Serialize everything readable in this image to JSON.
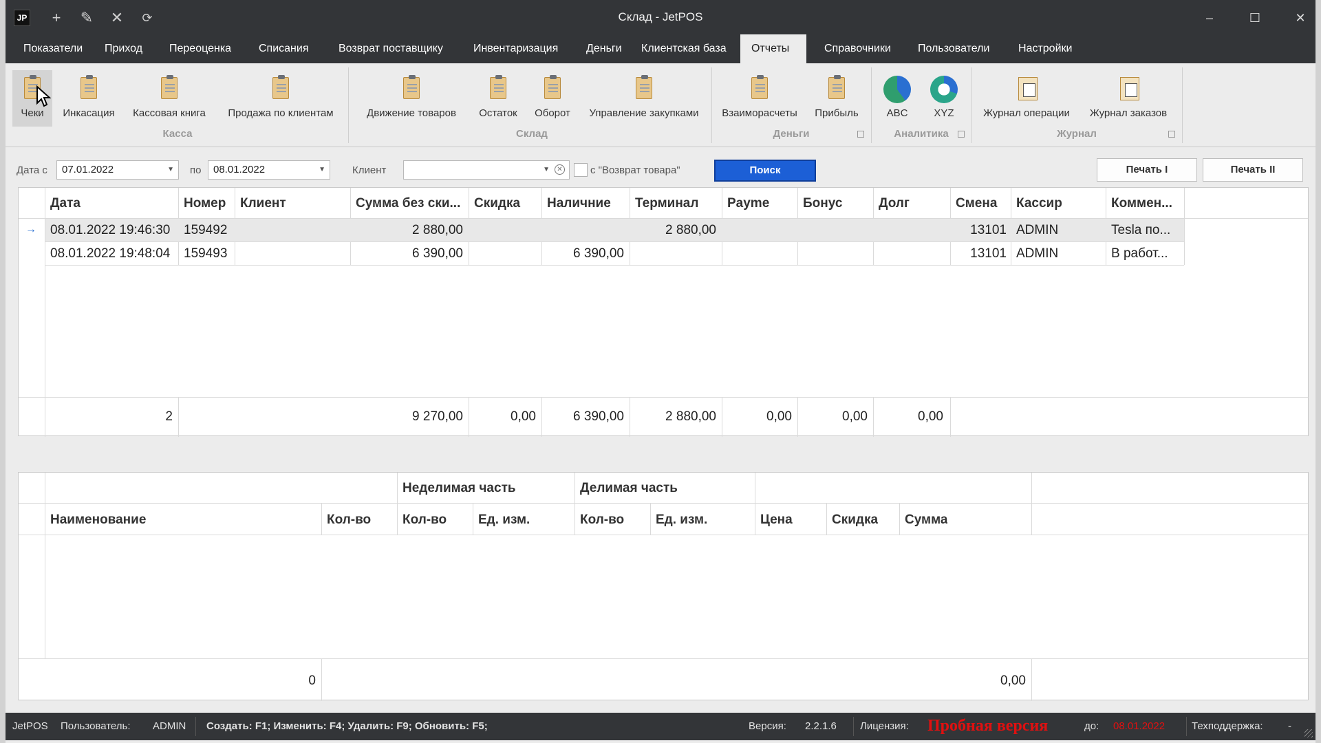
{
  "window": {
    "title": "Склад - JetPOS",
    "logo": "JP"
  },
  "toolbar_icons": [
    "plus-icon",
    "pencil-icon",
    "close-icon",
    "refresh-icon"
  ],
  "menu": {
    "tabs": [
      "Показатели",
      "Приход",
      "Переоценка",
      "Списания",
      "Возврат поставщику",
      "Инвентаризация",
      "Деньги",
      "Клиентская база",
      "Отчеты",
      "Справочники",
      "Пользователи",
      "Настройки"
    ],
    "active": "Отчеты"
  },
  "ribbon": {
    "groups": {
      "kassa": "Касса",
      "sklad": "Склад",
      "dengi": "Деньги",
      "analytics": "Аналитика",
      "journal": "Журнал"
    },
    "buttons": {
      "cheki": "Чеки",
      "inkassaciya": "Инкасация",
      "kassovaya_kniga": "Кассовая книга",
      "prodazha_po_klientam": "Продажа по клиентам",
      "dvizhenie_tovarov": "Движение товаров",
      "ostatok": "Остаток",
      "oborot": "Оборот",
      "upravlenie_zakupkami": "Управление закупками",
      "vzaimoraschety": "Взаиморасчеты",
      "pribyl": "Прибыль",
      "abc": "ABC",
      "xyz": "XYZ",
      "zhurnal_operacii": "Журнал операции",
      "zhurnal_zakazov": "Журнал заказов"
    },
    "colors": {
      "abc_green": "#2f9e6e",
      "abc_blue": "#2a6fd1",
      "xyz_teal": "#2aa58a"
    }
  },
  "filter": {
    "date_from_label": "Дата с",
    "date_from": "07.01.2022",
    "date_to_label": "по",
    "date_to": "08.01.2022",
    "client_label": "Клиент",
    "client_value": "",
    "return_checkbox_label": "с \"Возврат товара\"",
    "search_button": "Поиск",
    "print1": "Печать I",
    "print2": "Печать II"
  },
  "receipts": {
    "columns": [
      "Дата",
      "Номер",
      "Клиент",
      "Сумма без ски...",
      "Скидка",
      "Наличние",
      "Терминал",
      "Payme",
      "Бонус",
      "Долг",
      "Смена",
      "Кассир",
      "Коммен..."
    ],
    "rows": [
      {
        "date": "08.01.2022 19:46:30",
        "number": "159492",
        "client": "",
        "sum": "2 880,00",
        "discount": "",
        "cash": "",
        "terminal": "2 880,00",
        "payme": "",
        "bonus": "",
        "debt": "",
        "shift": "13101",
        "cashier": "ADMIN",
        "comment": "Tesla по..."
      },
      {
        "date": "08.01.2022 19:48:04",
        "number": "159493",
        "client": "",
        "sum": "6 390,00",
        "discount": "",
        "cash": "6 390,00",
        "terminal": "",
        "payme": "",
        "bonus": "",
        "debt": "",
        "shift": "13101",
        "cashier": "ADMIN",
        "comment": "В работ..."
      }
    ],
    "totals": {
      "count": "2",
      "sum": "9 270,00",
      "discount": "0,00",
      "cash": "6 390,00",
      "terminal": "2 880,00",
      "payme": "0,00",
      "bonus": "0,00",
      "debt": "0,00"
    },
    "selected_row_indicator": "→"
  },
  "items": {
    "band_indivisible": "Неделимая часть",
    "band_divisible": "Делимая часть",
    "columns": [
      "Наименование",
      "Кол-во",
      "Кол-во",
      "Ед. изм.",
      "Кол-во",
      "Ед. изм.",
      "Цена",
      "Скидка",
      "Сумма"
    ],
    "totals": {
      "count": "0",
      "sum": "0,00"
    }
  },
  "status": {
    "app": "JetPOS",
    "user_label": "Пользователь:",
    "user": "ADMIN",
    "hotkeys": "Создать: F1; Изменить: F4; Удалить: F9; Обновить: F5;",
    "version_label": "Версия:",
    "version": "2.2.1.6",
    "license_label": "Лицензия:",
    "license": "Пробная версия",
    "until_label": "до:",
    "until": "08.01.2022",
    "support_label": "Техподдержка:",
    "support": "-",
    "license_color": "#e01010"
  }
}
